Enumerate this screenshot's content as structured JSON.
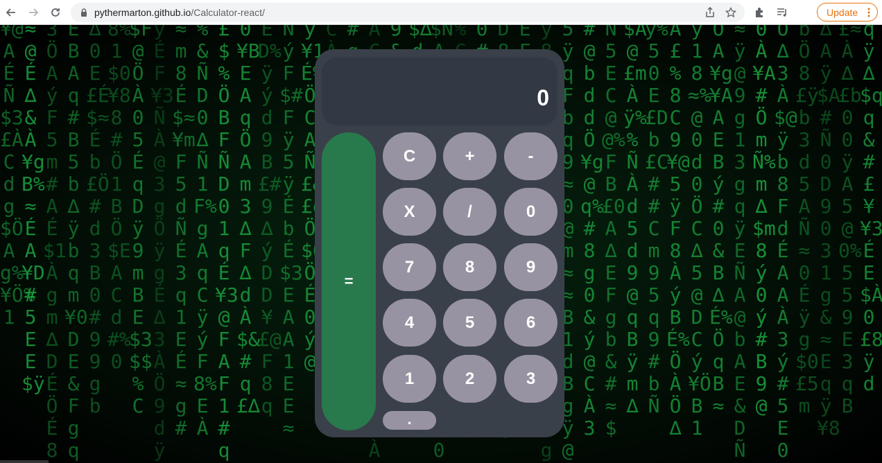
{
  "browser": {
    "url_domain": "pythermarton.github.io",
    "url_path": "/Calculator-react/",
    "update_label": "Update",
    "icons": [
      "back-icon",
      "forward-icon",
      "reload-icon",
      "lock-icon",
      "share-icon",
      "star-icon",
      "extensions-icon",
      "reading-list-icon",
      "more-icon"
    ],
    "accent_color": "#e8710a"
  },
  "calculator": {
    "display": "0",
    "equals_label": "=",
    "keys": [
      [
        "C",
        "+",
        "-"
      ],
      [
        "X",
        "/",
        "0"
      ],
      [
        "7",
        "8",
        "9"
      ],
      [
        "4",
        "5",
        "6"
      ],
      [
        "1",
        "2",
        "3"
      ],
      [
        "."
      ]
    ],
    "colors": {
      "body": "#3a4049",
      "display": "#323944",
      "key": "#9893a2",
      "equals": "#287a4c"
    }
  }
}
